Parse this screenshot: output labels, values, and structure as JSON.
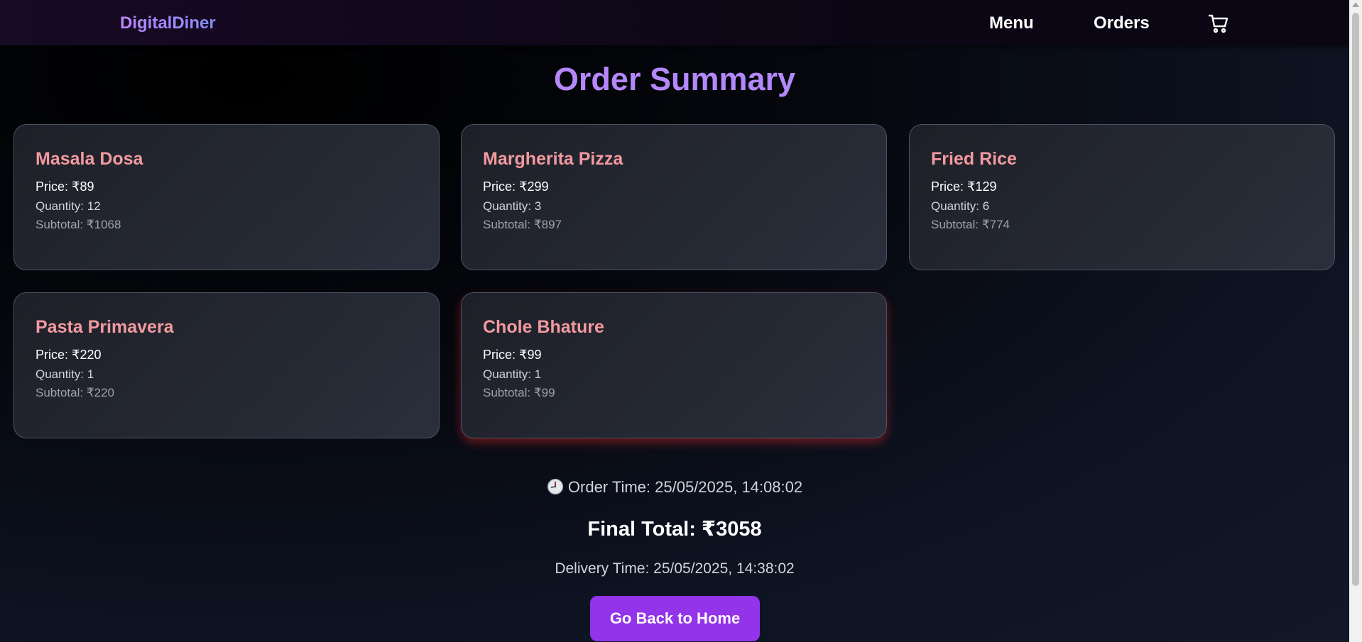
{
  "nav": {
    "brand": "DigitalDiner",
    "menu": "Menu",
    "orders": "Orders",
    "cart_icon": "cart-icon"
  },
  "page": {
    "title": "Order Summary"
  },
  "items": [
    {
      "name": "Masala Dosa",
      "price": "Price: ₹89",
      "quantity": "Quantity: 12",
      "subtotal": "Subtotal: ₹1068"
    },
    {
      "name": "Margherita Pizza",
      "price": "Price: ₹299",
      "quantity": "Quantity: 3",
      "subtotal": "Subtotal: ₹897"
    },
    {
      "name": "Fried Rice",
      "price": "Price: ₹129",
      "quantity": "Quantity: 6",
      "subtotal": "Subtotal: ₹774"
    },
    {
      "name": "Pasta Primavera",
      "price": "Price: ₹220",
      "quantity": "Quantity: 1",
      "subtotal": "Subtotal: ₹220"
    },
    {
      "name": "Chole Bhature",
      "price": "Price: ₹99",
      "quantity": "Quantity: 1",
      "subtotal": "Subtotal: ₹99"
    }
  ],
  "summary": {
    "order_time": "Order Time: 25/05/2025, 14:08:02",
    "final_total": "Final Total: ₹3058",
    "delivery_time": "Delivery Time: 25/05/2025, 14:38:02",
    "home_button": "Go Back to Home"
  },
  "colors": {
    "accent": "#9333ea",
    "brand": "#c084fc",
    "item_name": "#f29aa0"
  }
}
